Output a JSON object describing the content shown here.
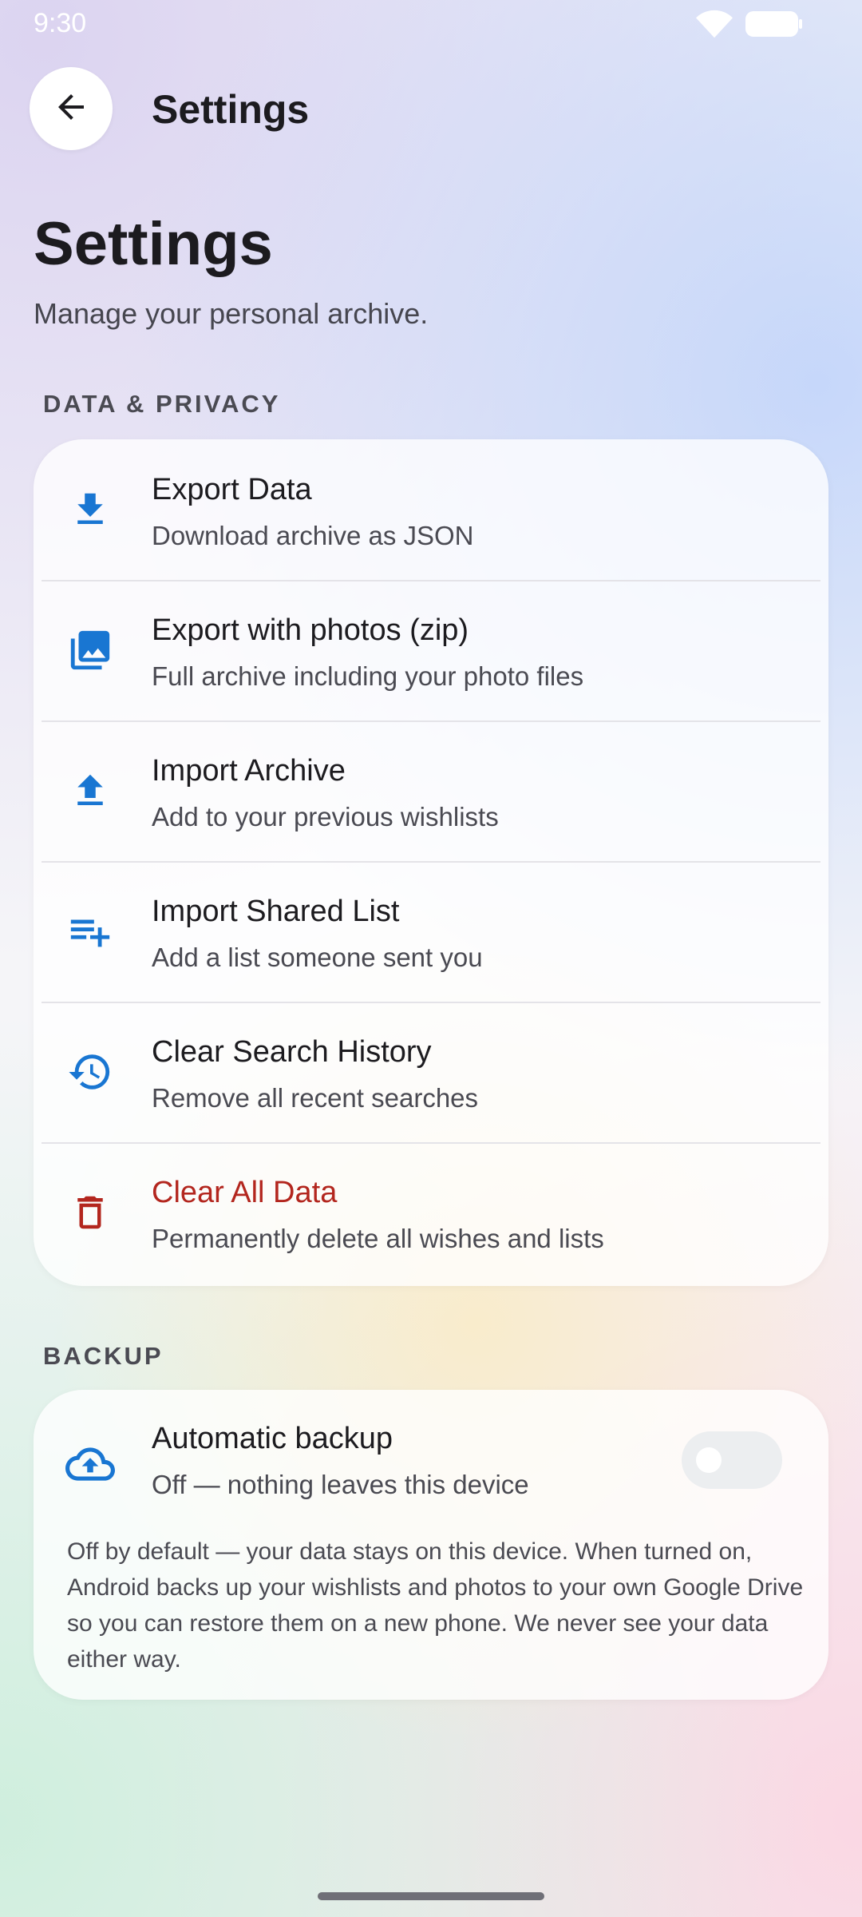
{
  "status_bar": {
    "time": "9:30"
  },
  "app_bar": {
    "title": "Settings"
  },
  "header": {
    "title": "Settings",
    "subtitle": "Manage your personal archive."
  },
  "sections": {
    "data_privacy": {
      "label": "DATA & PRIVACY",
      "items": [
        {
          "title": "Export Data",
          "subtitle": "Download archive as JSON",
          "icon": "download-icon"
        },
        {
          "title": "Export with photos (zip)",
          "subtitle": "Full archive including your photo files",
          "icon": "photo-library-icon"
        },
        {
          "title": "Import Archive",
          "subtitle": "Add to your previous wishlists",
          "icon": "upload-icon"
        },
        {
          "title": "Import Shared List",
          "subtitle": "Add a list someone sent you",
          "icon": "playlist-add-icon"
        },
        {
          "title": "Clear Search History",
          "subtitle": "Remove all recent searches",
          "icon": "history-icon"
        },
        {
          "title": "Clear All Data",
          "subtitle": "Permanently delete all wishes and lists",
          "icon": "trash-icon"
        }
      ]
    },
    "backup": {
      "label": "BACKUP",
      "title": "Automatic backup",
      "subtitle": "Off — nothing leaves this device",
      "icon": "cloud-upload-icon",
      "enabled": false,
      "note": "Off by default — your data stays on this device. When turned on, Android backs up your wishlists and photos to your own Google Drive so you can restore them on a new phone. We never see your data either way."
    }
  },
  "colors": {
    "accent": "#1976d2",
    "danger": "#b3261e",
    "text": "#1c1b1f",
    "muted": "#4a4a52"
  }
}
